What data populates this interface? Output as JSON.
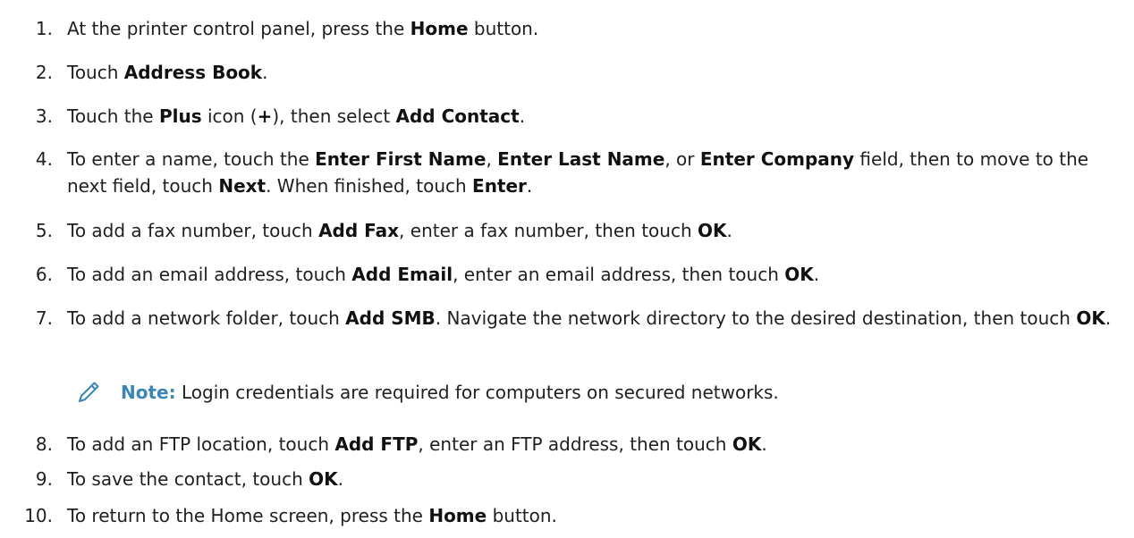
{
  "steps": [
    {
      "number": "1.",
      "parts": [
        {
          "t": "At the printer control panel, press the "
        },
        {
          "t": "Home",
          "b": true
        },
        {
          "t": " button."
        }
      ]
    },
    {
      "number": "2.",
      "parts": [
        {
          "t": "Touch "
        },
        {
          "t": "Address Book",
          "b": true
        },
        {
          "t": "."
        }
      ]
    },
    {
      "number": "3.",
      "parts": [
        {
          "t": "Touch the "
        },
        {
          "t": "Plus",
          "b": true
        },
        {
          "t": " icon ("
        },
        {
          "t": "+",
          "b": true
        },
        {
          "t": "), then select "
        },
        {
          "t": "Add Contact",
          "b": true
        },
        {
          "t": "."
        }
      ]
    },
    {
      "number": "4.",
      "parts": [
        {
          "t": "To enter a name, touch the "
        },
        {
          "t": "Enter First Name",
          "b": true
        },
        {
          "t": ", "
        },
        {
          "t": "Enter Last Name",
          "b": true
        },
        {
          "t": ", or "
        },
        {
          "t": "Enter Company",
          "b": true
        },
        {
          "t": " field, then to move to the next field, touch "
        },
        {
          "t": "Next",
          "b": true
        },
        {
          "t": ". When finished, touch "
        },
        {
          "t": "Enter",
          "b": true
        },
        {
          "t": "."
        }
      ]
    },
    {
      "number": "5.",
      "parts": [
        {
          "t": "To add a fax number, touch "
        },
        {
          "t": "Add Fax",
          "b": true
        },
        {
          "t": ", enter a fax number, then touch "
        },
        {
          "t": "OK",
          "b": true
        },
        {
          "t": "."
        }
      ]
    },
    {
      "number": "6.",
      "parts": [
        {
          "t": "To add an email address, touch "
        },
        {
          "t": "Add Email",
          "b": true
        },
        {
          "t": ", enter an email address, then touch "
        },
        {
          "t": "OK",
          "b": true
        },
        {
          "t": "."
        }
      ]
    },
    {
      "number": "7.",
      "parts": [
        {
          "t": "To add a network folder, touch "
        },
        {
          "t": "Add SMB",
          "b": true
        },
        {
          "t": ". Navigate the network directory to the desired destination, then touch "
        },
        {
          "t": "OK",
          "b": true
        },
        {
          "t": "."
        }
      ]
    },
    {
      "number": "8.",
      "parts": [
        {
          "t": "To add an FTP location, touch "
        },
        {
          "t": "Add FTP",
          "b": true
        },
        {
          "t": ", enter an FTP address, then touch "
        },
        {
          "t": "OK",
          "b": true
        },
        {
          "t": "."
        }
      ]
    },
    {
      "number": "9.",
      "parts": [
        {
          "t": "To save the contact, touch "
        },
        {
          "t": "OK",
          "b": true
        },
        {
          "t": "."
        }
      ]
    },
    {
      "number": "10.",
      "parts": [
        {
          "t": "To return to the Home screen, press the "
        },
        {
          "t": "Home",
          "b": true
        },
        {
          "t": " button."
        }
      ]
    }
  ],
  "note": {
    "icon": "pencil-icon",
    "label": "Note:",
    "text": " Login credentials are required for computers on secured networks.",
    "accent_color": "#3a86b4"
  }
}
